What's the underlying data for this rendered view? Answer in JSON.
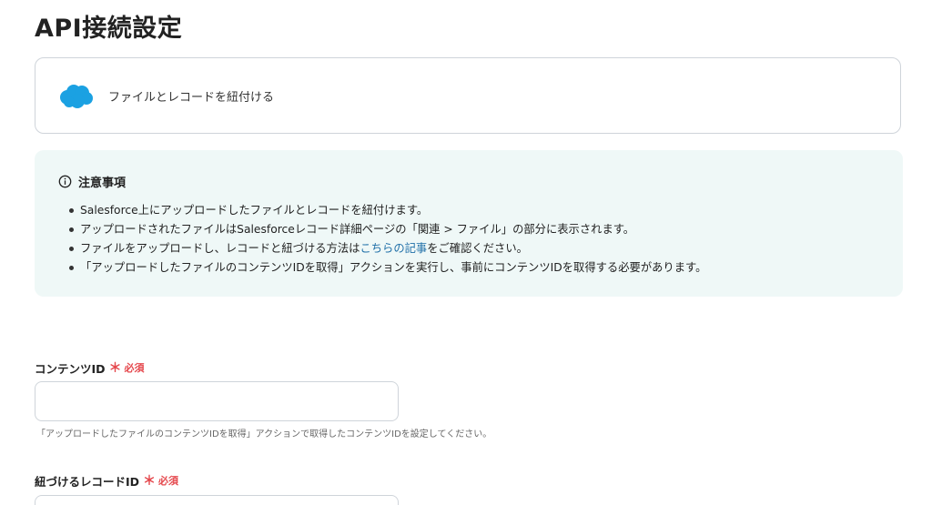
{
  "page": {
    "title": "API接続設定"
  },
  "action": {
    "label": "ファイルとレコードを紐付ける",
    "icon": "salesforce-cloud-icon",
    "brand_color": "#1ba1e2"
  },
  "notice": {
    "heading": "注意事項",
    "items": [
      {
        "text": "Salesforce上にアップロードしたファイルとレコードを紐付けます。"
      },
      {
        "text": "アップロードされたファイルはSalesforceレコード詳細ページの「関連 > ファイル」の部分に表示されます。"
      },
      {
        "before": "ファイルをアップロードし、レコードと紐づける方法は",
        "link": "こちらの記事",
        "after": "をご確認ください。"
      },
      {
        "text": "「アップロードしたファイルのコンテンツIDを取得」アクションを実行し、事前にコンテンツIDを取得する必要があります。"
      }
    ]
  },
  "fields": {
    "content_id": {
      "label": "コンテンツID",
      "required_mark": "＊",
      "required_text": "必須",
      "value": "",
      "help": "「アップロードしたファイルのコンテンツIDを取得」アクションで取得したコンテンツIDを設定してください。"
    },
    "record_id": {
      "label": "紐づけるレコードID",
      "required_mark": "＊",
      "required_text": "必須",
      "value": ""
    }
  },
  "colors": {
    "notice_bg": "#eff8f7",
    "required": "#e5484d",
    "link": "#1f6fa8",
    "border": "#cfd4da"
  }
}
